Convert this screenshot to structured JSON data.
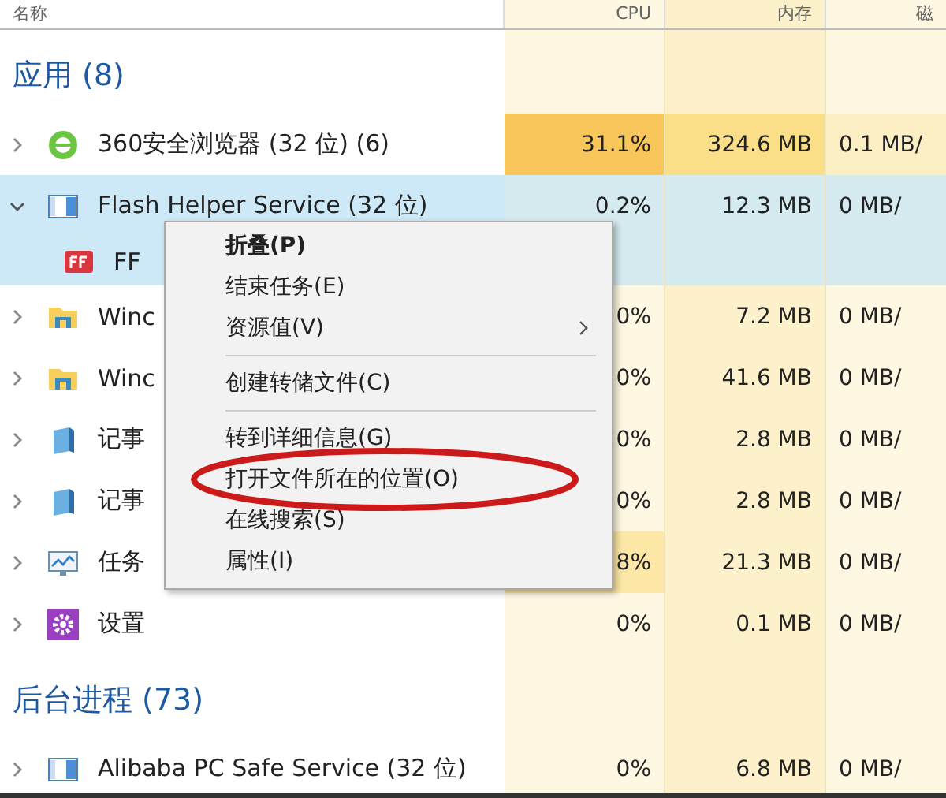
{
  "columns": [
    "名称",
    "CPU",
    "内存",
    "磁"
  ],
  "sections": [
    {
      "title": "应用 (8)",
      "rows": [
        {
          "kind": "browser",
          "name": "360安全浏览器 (32 位) (6)",
          "expanded": false,
          "selected": false,
          "cells": [
            {
              "text": "31.1%",
              "color": "#f8c65a"
            },
            {
              "text": "324.6 MB",
              "color": "#fbdf88"
            },
            {
              "text": "0.1 MB/",
              "color": "#fdefc4"
            }
          ]
        },
        {
          "kind": "window",
          "name": "Flash Helper Service (32 位)",
          "expanded": true,
          "selected": true,
          "cells": [
            {
              "text": "0.2%"
            },
            {
              "text": "12.3 MB"
            },
            {
              "text": "0 MB/"
            }
          ],
          "children": [
            {
              "kind": "flash",
              "name": "FF",
              "selected": true
            }
          ]
        },
        {
          "kind": "folder",
          "name": "Winc",
          "expanded": false,
          "selected": false,
          "cells": [
            {
              "text": "0%"
            },
            {
              "text": "7.2 MB"
            },
            {
              "text": "0 MB/"
            }
          ]
        },
        {
          "kind": "folder",
          "name": "Winc",
          "expanded": false,
          "selected": false,
          "cells": [
            {
              "text": "0%"
            },
            {
              "text": "41.6 MB"
            },
            {
              "text": "0 MB/"
            }
          ]
        },
        {
          "kind": "notepad",
          "name": "记事",
          "expanded": false,
          "selected": false,
          "cells": [
            {
              "text": "0%"
            },
            {
              "text": "2.8 MB"
            },
            {
              "text": "0 MB/"
            }
          ]
        },
        {
          "kind": "notepad",
          "name": "记事",
          "expanded": false,
          "selected": false,
          "cells": [
            {
              "text": "0%"
            },
            {
              "text": "2.8 MB"
            },
            {
              "text": "0 MB/"
            }
          ]
        },
        {
          "kind": "monitor",
          "name": "任务",
          "expanded": false,
          "selected": false,
          "cells": [
            {
              "text": "8%",
              "color": "#fce7a6"
            },
            {
              "text": "21.3 MB"
            },
            {
              "text": "0 MB/"
            }
          ]
        },
        {
          "kind": "gear",
          "name": "设置",
          "expanded": false,
          "selected": false,
          "cells": [
            {
              "text": "0%"
            },
            {
              "text": "0.1 MB"
            },
            {
              "text": "0 MB/"
            }
          ]
        }
      ]
    },
    {
      "title": "后台进程 (73)",
      "rows": [
        {
          "kind": "window",
          "name": "Alibaba PC Safe Service (32 位)",
          "expanded": false,
          "selected": false,
          "cells": [
            {
              "text": "0%"
            },
            {
              "text": "6.8 MB"
            },
            {
              "text": "0 MB/"
            }
          ]
        }
      ]
    }
  ],
  "context_menu": {
    "groups": [
      [
        {
          "label": "折叠(P)",
          "bold": true,
          "submenu": false,
          "circled": false
        },
        {
          "label": "结束任务(E)",
          "bold": false,
          "submenu": false,
          "circled": false
        },
        {
          "label": "资源值(V)",
          "bold": false,
          "submenu": true,
          "circled": false
        }
      ],
      [
        {
          "label": "创建转储文件(C)",
          "bold": false,
          "submenu": false,
          "circled": false
        }
      ],
      [
        {
          "label": "转到详细信息(G)",
          "bold": false,
          "submenu": false,
          "circled": false
        },
        {
          "label": "打开文件所在的位置(O)",
          "bold": false,
          "submenu": false,
          "circled": true
        },
        {
          "label": "在线搜索(S)",
          "bold": false,
          "submenu": false,
          "circled": false
        },
        {
          "label": "属性(I)",
          "bold": false,
          "submenu": false,
          "circled": false
        }
      ]
    ]
  }
}
